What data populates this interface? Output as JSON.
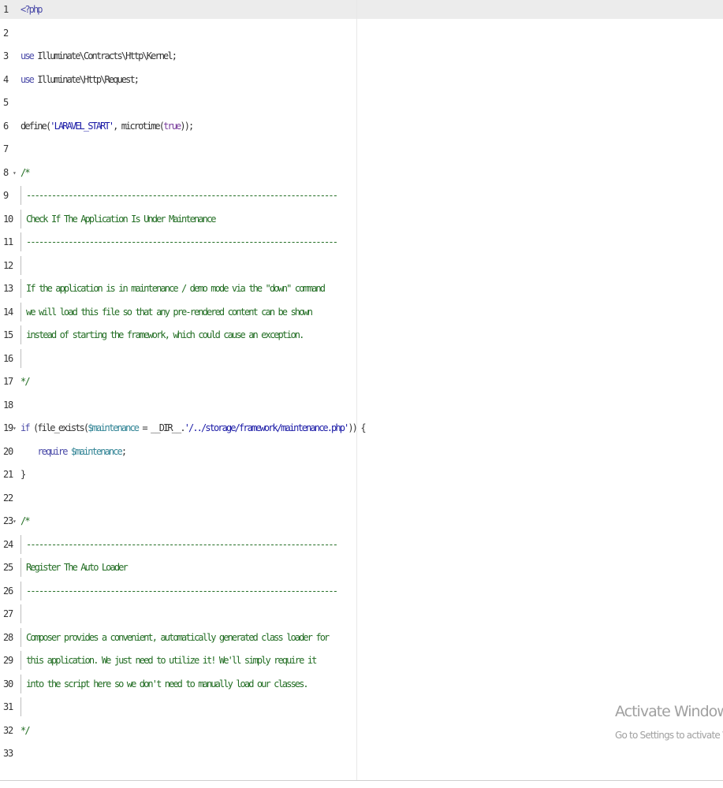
{
  "editor": {
    "language": "php",
    "lines": [
      {
        "no": "1",
        "tokens": [
          {
            "t": "<?php",
            "c": "kw"
          }
        ]
      },
      {
        "no": "2",
        "tokens": []
      },
      {
        "no": "3",
        "tokens": [
          {
            "t": "use",
            "c": "kw"
          },
          {
            "t": " Illuminate\\Contracts\\Http\\Kernel;",
            "c": ""
          }
        ]
      },
      {
        "no": "4",
        "tokens": [
          {
            "t": "use",
            "c": "kw"
          },
          {
            "t": " Illuminate\\Http\\Request;",
            "c": ""
          }
        ]
      },
      {
        "no": "5",
        "tokens": []
      },
      {
        "no": "6",
        "tokens": [
          {
            "t": "define(",
            "c": ""
          },
          {
            "t": "'LARAVEL_START'",
            "c": "str"
          },
          {
            "t": ", microtime(",
            "c": ""
          },
          {
            "t": "true",
            "c": "cst"
          },
          {
            "t": "));",
            "c": ""
          }
        ]
      },
      {
        "no": "7",
        "tokens": []
      },
      {
        "no": "8",
        "fold": true,
        "tokens": [
          {
            "t": "/*",
            "c": "cmt"
          }
        ]
      },
      {
        "no": "9",
        "bar": true,
        "tokens": [
          {
            "t": "--------------------------------------------------------------------------",
            "c": "cmt"
          }
        ]
      },
      {
        "no": "10",
        "bar": true,
        "tokens": [
          {
            "t": "Check If The Application Is Under Maintenance",
            "c": "cmt"
          }
        ]
      },
      {
        "no": "11",
        "bar": true,
        "tokens": [
          {
            "t": "--------------------------------------------------------------------------",
            "c": "cmt"
          }
        ]
      },
      {
        "no": "12",
        "bar": true,
        "tokens": []
      },
      {
        "no": "13",
        "bar": true,
        "tokens": [
          {
            "t": "If the application is in maintenance / demo mode via the \"down\" command",
            "c": "cmt"
          }
        ]
      },
      {
        "no": "14",
        "bar": true,
        "tokens": [
          {
            "t": "we will load this file so that any pre-rendered content can be shown",
            "c": "cmt"
          }
        ]
      },
      {
        "no": "15",
        "bar": true,
        "tokens": [
          {
            "t": "instead of starting the framework, which could cause an exception.",
            "c": "cmt"
          }
        ]
      },
      {
        "no": "16",
        "bar": true,
        "tokens": []
      },
      {
        "no": "17",
        "tokens": [
          {
            "t": "*/",
            "c": "cmt"
          }
        ]
      },
      {
        "no": "18",
        "tokens": []
      },
      {
        "no": "19",
        "fold": true,
        "tokens": [
          {
            "t": "if",
            "c": "kw"
          },
          {
            "t": " (file_exists(",
            "c": ""
          },
          {
            "t": "$maintenance",
            "c": "var"
          },
          {
            "t": " = __DIR__.",
            "c": ""
          },
          {
            "t": "'/../storage/framework/maintenance.php'",
            "c": "str"
          },
          {
            "t": ")) {",
            "c": ""
          }
        ]
      },
      {
        "no": "20",
        "tokens": [
          {
            "t": "    ",
            "c": ""
          },
          {
            "t": "require",
            "c": "kw"
          },
          {
            "t": " ",
            "c": ""
          },
          {
            "t": "$maintenance",
            "c": "var"
          },
          {
            "t": ";",
            "c": ""
          }
        ]
      },
      {
        "no": "21",
        "tokens": [
          {
            "t": "}",
            "c": ""
          }
        ]
      },
      {
        "no": "22",
        "tokens": []
      },
      {
        "no": "23",
        "fold": true,
        "tokens": [
          {
            "t": "/*",
            "c": "cmt"
          }
        ]
      },
      {
        "no": "24",
        "bar": true,
        "tokens": [
          {
            "t": "--------------------------------------------------------------------------",
            "c": "cmt"
          }
        ]
      },
      {
        "no": "25",
        "bar": true,
        "tokens": [
          {
            "t": "Register The Auto Loader",
            "c": "cmt"
          }
        ]
      },
      {
        "no": "26",
        "bar": true,
        "tokens": [
          {
            "t": "--------------------------------------------------------------------------",
            "c": "cmt"
          }
        ]
      },
      {
        "no": "27",
        "bar": true,
        "tokens": []
      },
      {
        "no": "28",
        "bar": true,
        "tokens": [
          {
            "t": "Composer provides a convenient, automatically generated class loader for",
            "c": "cmt"
          }
        ]
      },
      {
        "no": "29",
        "bar": true,
        "tokens": [
          {
            "t": "this application. We just need to utilize it! We'll simply require it",
            "c": "cmt"
          }
        ]
      },
      {
        "no": "30",
        "bar": true,
        "tokens": [
          {
            "t": "into the script here so we don't need to manually load our classes.",
            "c": "cmt"
          }
        ]
      },
      {
        "no": "31",
        "bar": true,
        "tokens": []
      },
      {
        "no": "32",
        "tokens": [
          {
            "t": "*/",
            "c": "cmt"
          }
        ]
      },
      {
        "no": "33",
        "tokens": []
      }
    ]
  },
  "watermark": {
    "title": "Activate Windows",
    "subtitle": "Go to Settings to activate Windows."
  },
  "colors": {
    "keyword": "#4a4aa8",
    "string": "#1a1aa6",
    "variable": "#318495",
    "comment": "#236e24",
    "constant": "#7a3e9d",
    "active_line": "#ececec"
  }
}
